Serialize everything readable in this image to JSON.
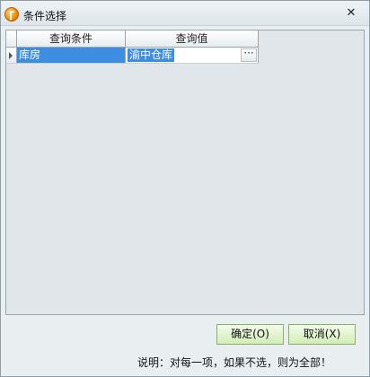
{
  "window": {
    "title": "条件选择",
    "close_glyph": "✕"
  },
  "grid": {
    "columns": [
      "查询条件",
      "查询值"
    ],
    "rows": [
      {
        "condition": "库房",
        "value": "渝中仓库"
      }
    ],
    "ellipsis": "···"
  },
  "buttons": {
    "ok": "确定(O)",
    "cancel": "取消(X)"
  },
  "note": "说明：对每一项，如果不选，则为全部！"
}
